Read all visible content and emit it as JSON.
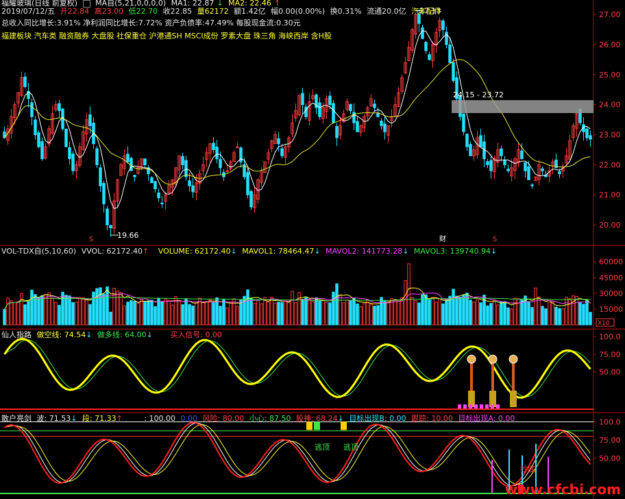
{
  "colors": {
    "up": "#ff3b3b",
    "down": "#24e0ff",
    "ma1": "#ffffff",
    "ma2": "#e8e830",
    "grid": "#7a0000",
    "axis": "#cc0000",
    "panelbg": "#000000"
  },
  "main": {
    "title": "福耀玻璃(日线 前复权)",
    "indicator": "MA自(5,21,0,0,0,0)",
    "ma1": "MA1: 22.87",
    "ma1_arrow": "↓",
    "ma2": "MA2: 22.46",
    "ma2_arrow": "↑",
    "quote": {
      "date": "2019/07/12/五",
      "open": "开22.84",
      "high": "高23.00",
      "low": "低22.70",
      "close": "收22.85",
      "vol": "量62172",
      "amount": "额1.42亿",
      "change": "幅0.00(0.00%)",
      "turnover": "换0.31%",
      "float": "流通20.0亿",
      "sector": "汽车配件"
    },
    "fundamentals": "总收入同比增长:3.91%  净利润同比增长:7.72%  资产负债率:47.49%  每股现金流:0.30元",
    "concepts": "福建板块 汽车类 融资融券 大盘股 社保重仓 沪港通SH MSCI成份 罗素大盘 珠三角 海峡西岸 含H股",
    "annotations": {
      "high": "27.13",
      "low": "19.66",
      "gap": "24.15 - 23.72",
      "marker_s": "S",
      "marker_cai": "财"
    }
  },
  "volume": {
    "title": "VOL-TDX自(5,10,60)",
    "vvol": "VVOL: 62172.40",
    "volume": "VOLUME: 62172.40",
    "mavol1": "MAVOL1: 78464.47",
    "mavol2": "MAVOL2: 141773.28",
    "mavol3": "MAVOL3: 139740.94",
    "unit": "X10"
  },
  "xianren": {
    "title": "仙人指路",
    "short": "做空线: 74.54",
    "long": "做多线: 64.00",
    "buy": "买入信号: 0.00"
  },
  "sanhu": {
    "title": "散户亮剑",
    "wave": "波: 71.53",
    "seg": "段: 71.33",
    "v100": ": 100.00",
    "v0": "0.00",
    "risk": "风险: 80.00",
    "care": "小心: 87.50",
    "heart": "股神: 68.24",
    "targetB": "目标出现B: 0.00",
    "follow": "跟踪: 10.00",
    "targetA": "目标出现A: 0.00",
    "escape": "逃顶",
    "bottom": "抄底"
  },
  "watermark": "www.cfcbi.com",
  "chart_data": [
    {
      "type": "candlestick",
      "title": "福耀玻璃(日线 前复权)",
      "ylim": [
        19.5,
        27.3
      ],
      "yticks": [
        "27.00",
        "26.00",
        "25.00",
        "24.00",
        "23.00",
        "22.00",
        "21.00",
        "20.00"
      ],
      "close": [
        22.9,
        23.2,
        23.6,
        24.0,
        24.4,
        24.9,
        24.6,
        24.2,
        23.6,
        23.0,
        22.6,
        22.2,
        22.6,
        23.2,
        23.7,
        24.0,
        23.8,
        23.2,
        22.6,
        22.2,
        21.8,
        22.0,
        22.6,
        23.1,
        23.5,
        23.3,
        22.7,
        22.0,
        21.3,
        20.7,
        20.0,
        19.9,
        20.8,
        21.5,
        22.0,
        22.3,
        22.1,
        21.8,
        21.6,
        21.9,
        22.2,
        22.0,
        21.7,
        21.4,
        21.2,
        20.9,
        20.7,
        21.0,
        21.3,
        21.5,
        21.9,
        22.3,
        22.0,
        21.6,
        21.3,
        21.1,
        21.4,
        21.7,
        22.0,
        22.4,
        22.7,
        22.5,
        22.2,
        21.9,
        21.6,
        21.8,
        22.1,
        22.4,
        22.6,
        22.1,
        21.6,
        21.0,
        20.6,
        21.0,
        21.5,
        21.8,
        22.1,
        22.4,
        22.8,
        23.0,
        22.7,
        22.3,
        22.6,
        22.9,
        23.4,
        23.8,
        24.3,
        24.0,
        23.6,
        24.1,
        24.3,
        23.9,
        23.6,
        23.9,
        24.2,
        24.0,
        23.4,
        22.9,
        23.3,
        23.7,
        24.1,
        23.8,
        23.4,
        23.1,
        23.3,
        23.6,
        23.9,
        24.2,
        23.9,
        23.6,
        23.3,
        23.1,
        23.3,
        23.6,
        24.0,
        24.4,
        24.9,
        25.4,
        25.9,
        26.5,
        27.0,
        26.7,
        26.2,
        25.8,
        25.5,
        26.0,
        26.4,
        26.8,
        26.5,
        26.0,
        25.4,
        24.8,
        24.2,
        23.6,
        23.1,
        22.6,
        22.3,
        22.5,
        22.9,
        22.6,
        22.2,
        22.0,
        21.8,
        22.2,
        22.5,
        22.3,
        22.0,
        21.8,
        21.9,
        22.2,
        22.5,
        22.2,
        21.8,
        21.5,
        21.3,
        21.6,
        22.0,
        21.8,
        21.6,
        21.8,
        22.1,
        21.9,
        21.7,
        21.9,
        22.3,
        22.8,
        23.3,
        23.7,
        23.4,
        23.1,
        22.9,
        22.85
      ]
    },
    {
      "type": "bar",
      "title": "VOL-TDX自(5,10,60)",
      "ylim": [
        0,
        65000
      ],
      "yticks": [
        "60000",
        "45000",
        "30000",
        "15000"
      ]
    },
    {
      "type": "line",
      "title": "仙人指路",
      "ylim": [
        0,
        105
      ],
      "yticks": [
        "100.0",
        "75.00",
        "50.00"
      ]
    },
    {
      "type": "line",
      "title": "散户亮剑",
      "ylim": [
        0,
        105
      ],
      "yticks": [
        "100.0",
        "75.00",
        "50.00"
      ]
    }
  ]
}
